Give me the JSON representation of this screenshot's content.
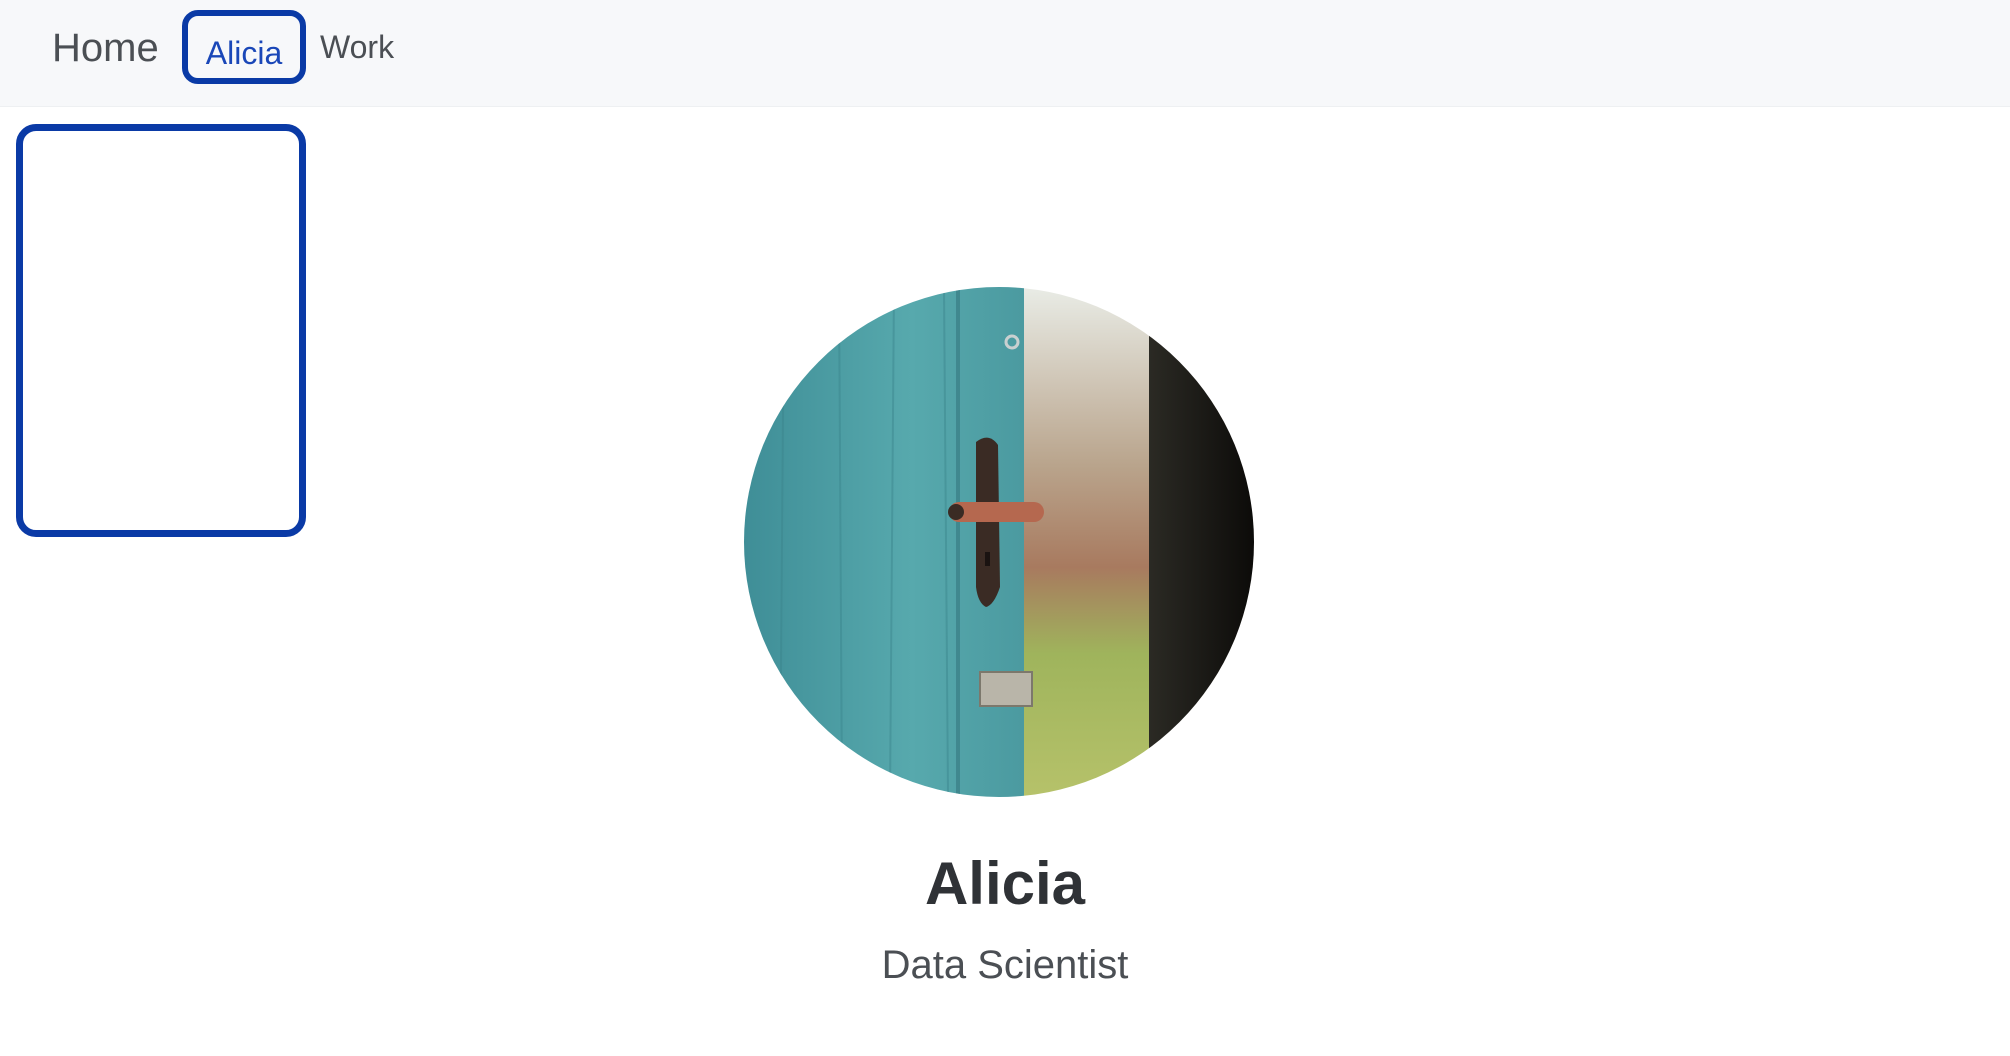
{
  "navbar": {
    "brand": "Home",
    "links": [
      {
        "label": "Alicia",
        "active": true
      },
      {
        "label": "Work",
        "active": false
      }
    ]
  },
  "profile": {
    "name": "Alicia",
    "title": "Data Scientist",
    "avatar_icon": "profile-photo-door-image"
  },
  "colors": {
    "navbar_bg": "#f7f8fa",
    "focus_outline": "#0a3aa6",
    "active_link": "#1a47b8",
    "text": "#4b4f54",
    "heading": "#2f3236",
    "door_teal": "#4fa0a6"
  }
}
